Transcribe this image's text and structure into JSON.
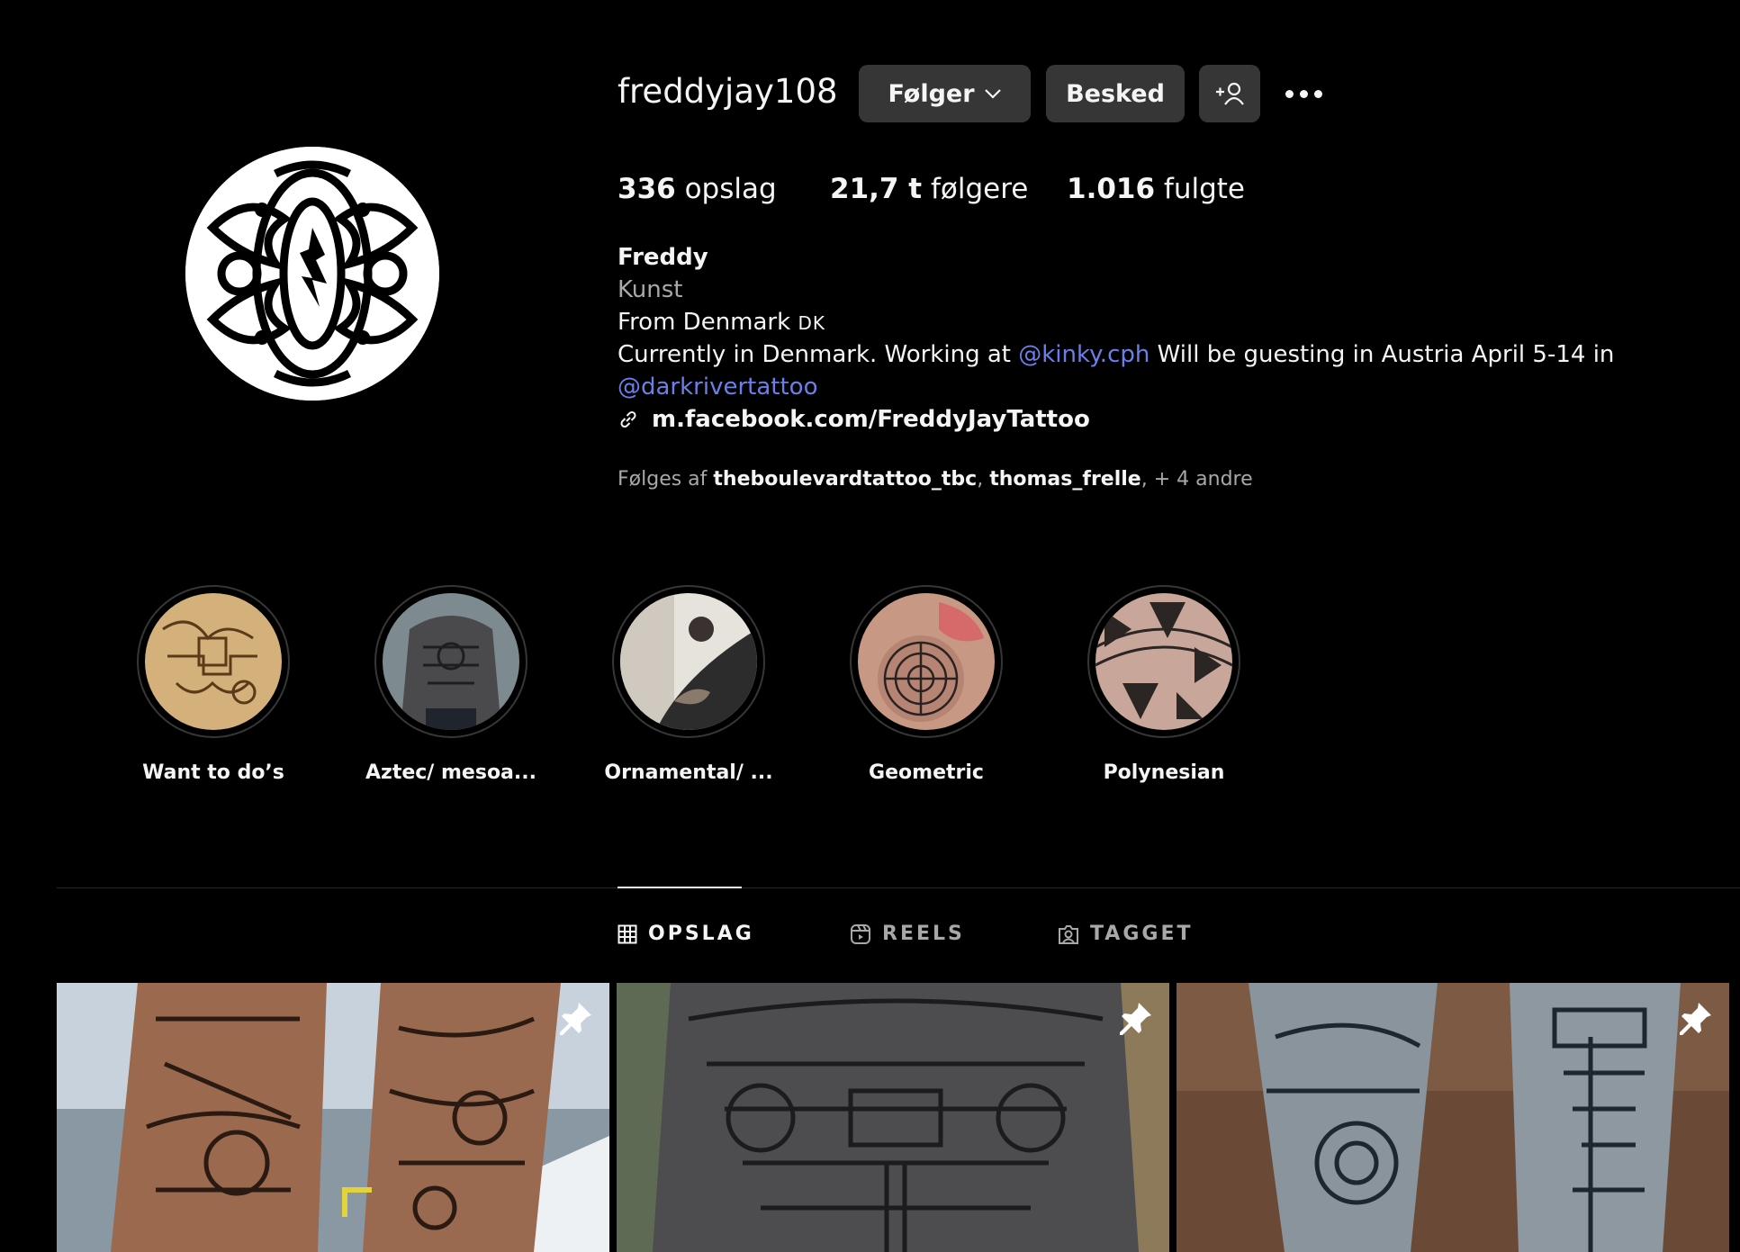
{
  "profile": {
    "username": "freddyjay108",
    "follow_label": "Følger",
    "message_label": "Besked",
    "stats": {
      "posts_value": "336",
      "posts_label": " opslag",
      "followers_value": "21,7 t",
      "followers_label": " følgere",
      "following_value": "1.016",
      "following_label": " fulgte"
    },
    "bio": {
      "name": "Freddy",
      "category": "Kunst",
      "from_text": "From Denmark ",
      "from_flag": "DK",
      "current_prefix": "Currently in Denmark. Working at ",
      "mention1": "@kinky.cph",
      "current_suffix": " Will be guesting in Austria April 5-14 in",
      "mention2": "@darkrivertattoo",
      "link": "m.facebook.com/FreddyJayTattoo"
    },
    "followed_by": {
      "prefix": "Følges af ",
      "user1": "theboulevardtattoo_tbc",
      "sep": ", ",
      "user2": "thomas_frelle",
      "suffix": ", + 4 andre"
    }
  },
  "highlights": [
    {
      "label": "Want to do’s"
    },
    {
      "label": "Aztec/ mesoa..."
    },
    {
      "label": "Ornamental/ ..."
    },
    {
      "label": "Geometric"
    },
    {
      "label": "Polynesian"
    }
  ],
  "tabs": [
    {
      "label": "OPSLAG",
      "icon": "grid-icon",
      "active": true
    },
    {
      "label": "REELS",
      "icon": "reels-icon",
      "active": false
    },
    {
      "label": "TAGGET",
      "icon": "tagged-icon",
      "active": false
    }
  ],
  "posts": [
    {
      "pinned": true
    },
    {
      "pinned": true
    },
    {
      "pinned": true
    }
  ],
  "colors": {
    "background": "#000000",
    "button": "#363636",
    "mention": "#6b7fe8",
    "secondary_text": "#a8a8a8"
  }
}
